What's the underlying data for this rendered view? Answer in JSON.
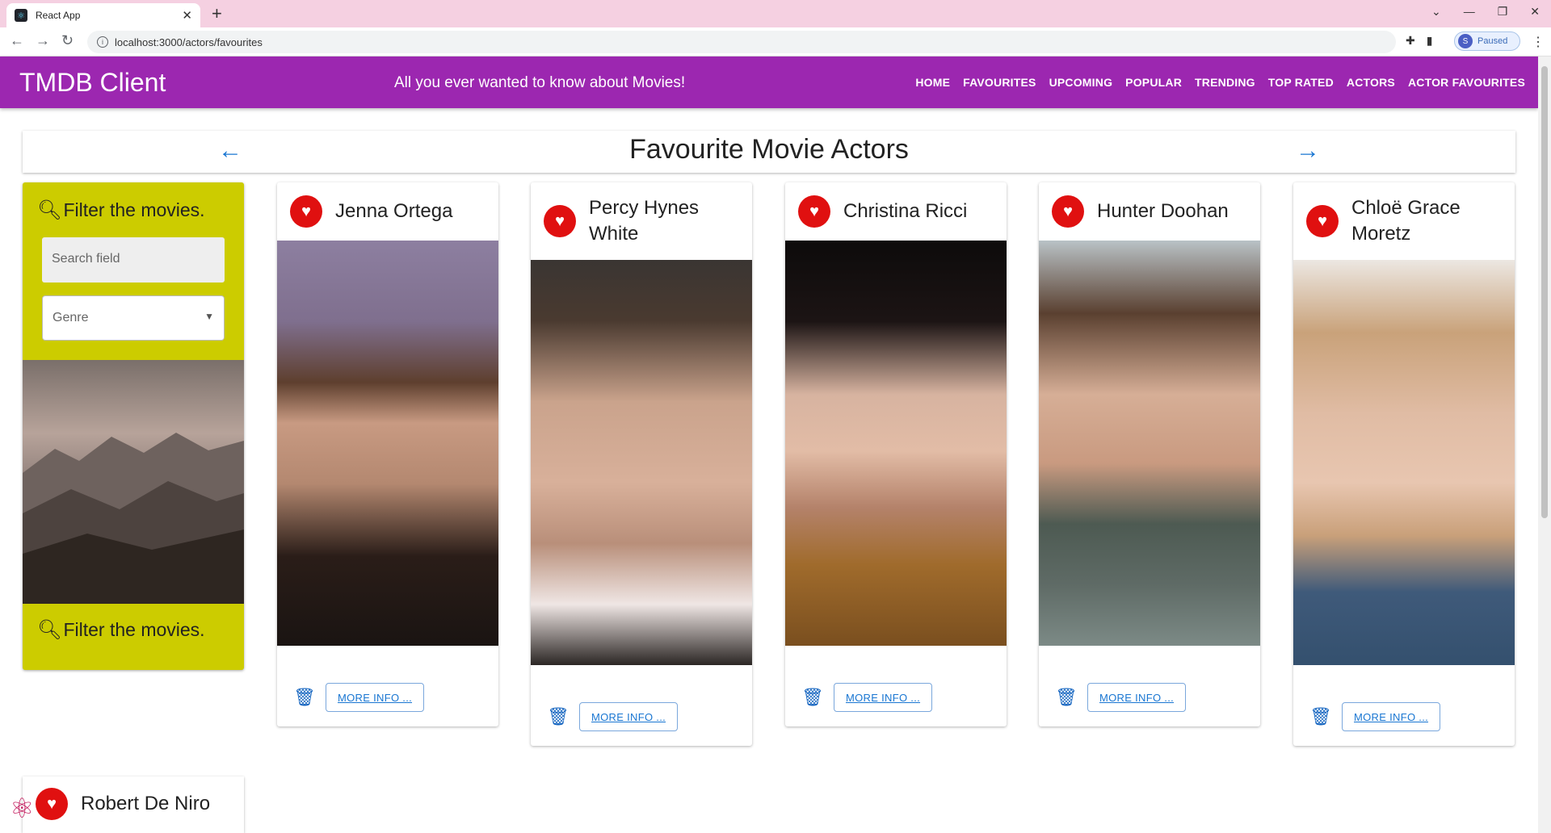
{
  "browser": {
    "tab_title": "React App",
    "url": "localhost:3000/actors/favourites",
    "profile_initial": "S",
    "profile_status": "Paused"
  },
  "appbar": {
    "brand": "TMDB Client",
    "tagline": "All you ever wanted to know about Movies!",
    "menu": [
      "HOME",
      "FAVOURITES",
      "UPCOMING",
      "POPULAR",
      "TRENDING",
      "TOP RATED",
      "ACTORS",
      "ACTOR FAVOURITES"
    ]
  },
  "page": {
    "title": "Favourite Movie Actors"
  },
  "filter": {
    "heading": "Filter the movies.",
    "search_placeholder": "Search field",
    "genre_label": "Genre",
    "footer_heading": "Filter the movies."
  },
  "actors": [
    {
      "name": "Jenna Ortega",
      "more": "MORE INFO ..."
    },
    {
      "name": "Percy Hynes White",
      "more": "MORE INFO ..."
    },
    {
      "name": "Christina Ricci",
      "more": "MORE INFO ..."
    },
    {
      "name": "Hunter Doohan",
      "more": "MORE INFO ..."
    },
    {
      "name": "Chloë Grace Moretz",
      "more": "MORE INFO ..."
    },
    {
      "name": "Robert De Niro"
    }
  ],
  "colors": {
    "appbar": "#9c27b0",
    "filter_bg": "#cccc00",
    "heart": "#e01010",
    "accent": "#1976d2"
  }
}
